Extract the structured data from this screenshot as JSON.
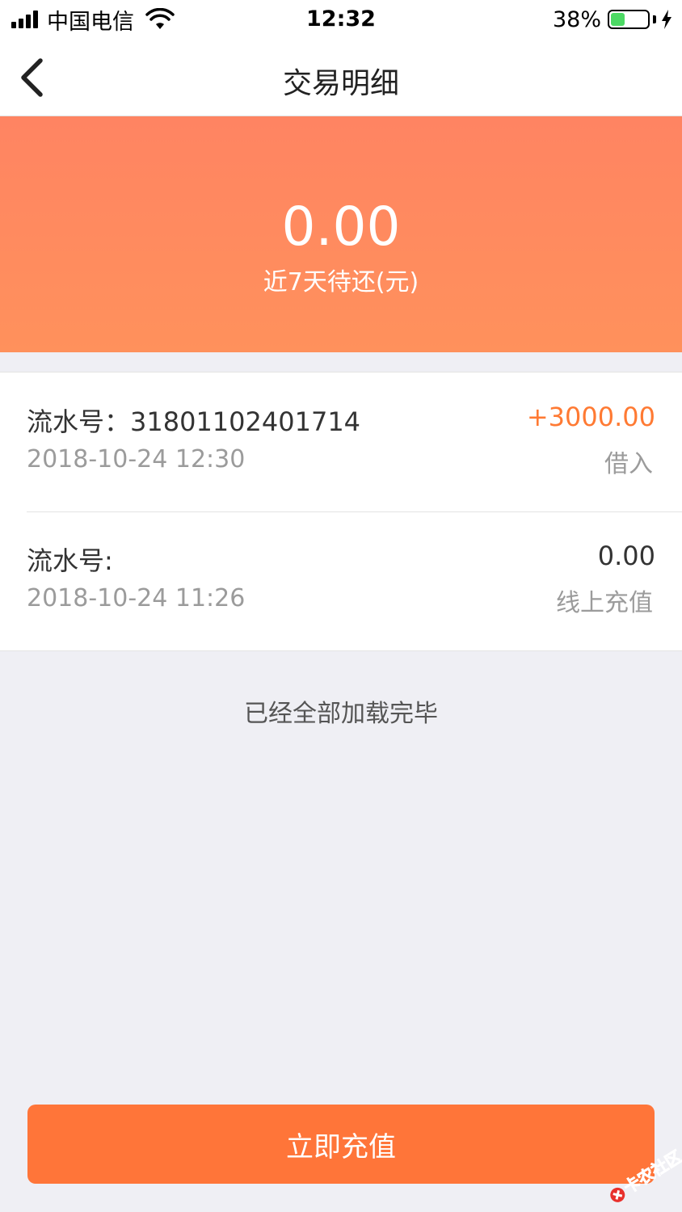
{
  "status_bar": {
    "carrier": "中国电信",
    "time": "12:32",
    "battery": "38%",
    "battery_level": 0.38
  },
  "nav": {
    "title": "交易明细",
    "back_icon": "chevron-left-icon"
  },
  "banner": {
    "amount": "0.00",
    "caption": "近7天待还(元)"
  },
  "transactions": [
    {
      "serial": "流水号：31801102401714",
      "time": "2018-10-24 12:30",
      "amount": "+3000.00",
      "type": "借入"
    },
    {
      "serial": "流水号:",
      "time": "2018-10-24 11:26",
      "amount": "0.00",
      "type": "线上充值"
    }
  ],
  "load_done": "已经全部加载完毕",
  "recharge_button": "立即充值",
  "watermark": {
    "text": "卡农社区"
  },
  "colors": {
    "accent": "#ff7539",
    "banner_top": "#ff8462",
    "banner_bottom": "#ff915c",
    "positive_amount": "#ff7a33"
  }
}
